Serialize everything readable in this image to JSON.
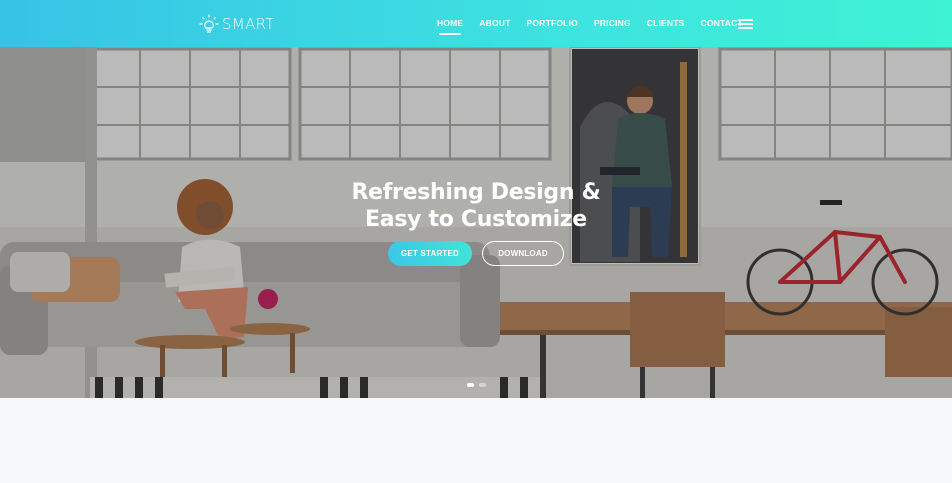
{
  "brand": {
    "name": "SMART",
    "icon": "lightbulb-icon"
  },
  "nav": {
    "items": [
      {
        "label": "HOME",
        "active": true
      },
      {
        "label": "ABOUT",
        "active": false
      },
      {
        "label": "PORTFOLIO",
        "active": false
      },
      {
        "label": "PRICING",
        "active": false
      },
      {
        "label": "CLIENTS",
        "active": false
      },
      {
        "label": "CONTACT",
        "active": false
      }
    ],
    "menu_icon": "hamburger-menu-icon"
  },
  "hero": {
    "title_line1": "Refreshing Design &",
    "title_line2": "Easy to Customize",
    "primary_button": "GET STARTED",
    "secondary_button": "DOWNLOAD",
    "slider": {
      "slide_count": 2,
      "active_slide": 1
    }
  },
  "colors": {
    "header_gradient_start": "#36c3e6",
    "header_gradient_end": "#3ef2d4",
    "accent": "#3ec6e6",
    "page_background": "#f7f8fa"
  }
}
